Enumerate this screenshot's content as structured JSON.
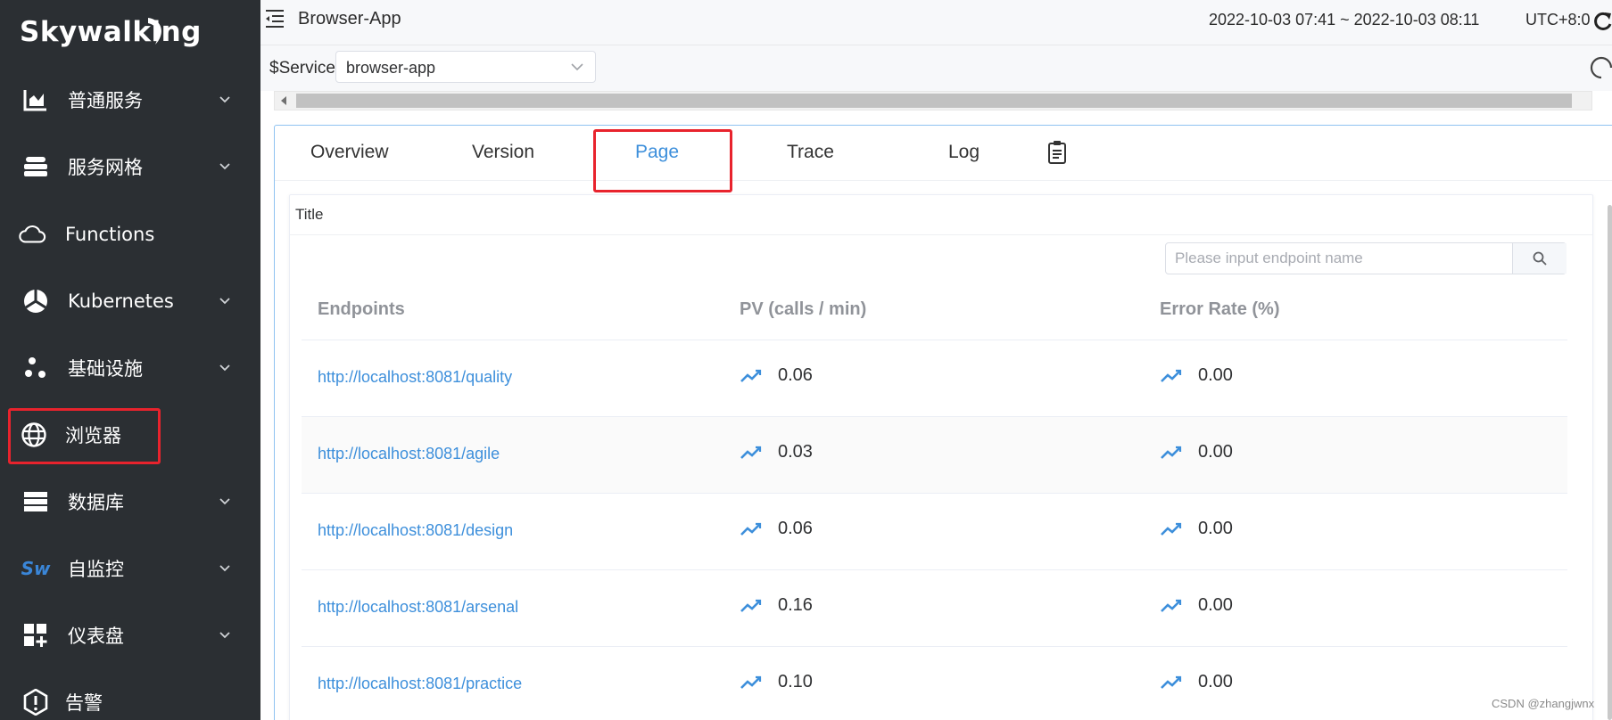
{
  "sidebar": {
    "logo": "Skywalking",
    "items": [
      {
        "label": "普通服务",
        "icon": "bar-chart-icon",
        "has_arrow": true
      },
      {
        "label": "服务网格",
        "icon": "layers-icon",
        "has_arrow": true
      },
      {
        "label": "Functions",
        "icon": "cloud-icon",
        "has_arrow": false
      },
      {
        "label": "Kubernetes",
        "icon": "pie-icon",
        "has_arrow": true
      },
      {
        "label": "基础设施",
        "icon": "dots-icon",
        "has_arrow": true
      },
      {
        "label": "浏览器",
        "icon": "globe-icon",
        "has_arrow": false
      },
      {
        "label": "数据库",
        "icon": "database-icon",
        "has_arrow": true
      },
      {
        "label": "自监控",
        "icon": "sw-icon",
        "badge": "Sw",
        "has_arrow": true
      },
      {
        "label": "仪表盘",
        "icon": "dashboard-add-icon",
        "has_arrow": true
      },
      {
        "label": "告警",
        "icon": "alert-icon",
        "has_arrow": false
      }
    ]
  },
  "header": {
    "title": "Browser-App",
    "time_range": "2022-10-03 07:41 ~ 2022-10-03 08:11",
    "timezone": "UTC+8:0"
  },
  "service_bar": {
    "label": "$Service",
    "selected": "browser-app"
  },
  "tabs": [
    {
      "label": "Overview",
      "active": false
    },
    {
      "label": "Version",
      "active": false
    },
    {
      "label": "Page",
      "active": true
    },
    {
      "label": "Trace",
      "active": false
    },
    {
      "label": "Log",
      "active": false
    }
  ],
  "card": {
    "title": "Title",
    "search_placeholder": "Please input endpoint name"
  },
  "table": {
    "headers": [
      "Endpoints",
      "PV (calls / min)",
      "Error Rate (%)"
    ],
    "rows": [
      {
        "endpoint": "http://localhost:8081/quality",
        "pv": "0.06",
        "error_rate": "0.00"
      },
      {
        "endpoint": "http://localhost:8081/agile",
        "pv": "0.03",
        "error_rate": "0.00"
      },
      {
        "endpoint": "http://localhost:8081/design",
        "pv": "0.06",
        "error_rate": "0.00"
      },
      {
        "endpoint": "http://localhost:8081/arsenal",
        "pv": "0.16",
        "error_rate": "0.00"
      },
      {
        "endpoint": "http://localhost:8081/practice",
        "pv": "0.10",
        "error_rate": "0.00"
      }
    ]
  },
  "watermark": "CSDN @zhangjwnx",
  "colors": {
    "sidebar_bg": "#2b2f33",
    "accent": "#3d8fdb",
    "highlight_red": "#e8232d",
    "sw_blue": "#3a86d8"
  }
}
